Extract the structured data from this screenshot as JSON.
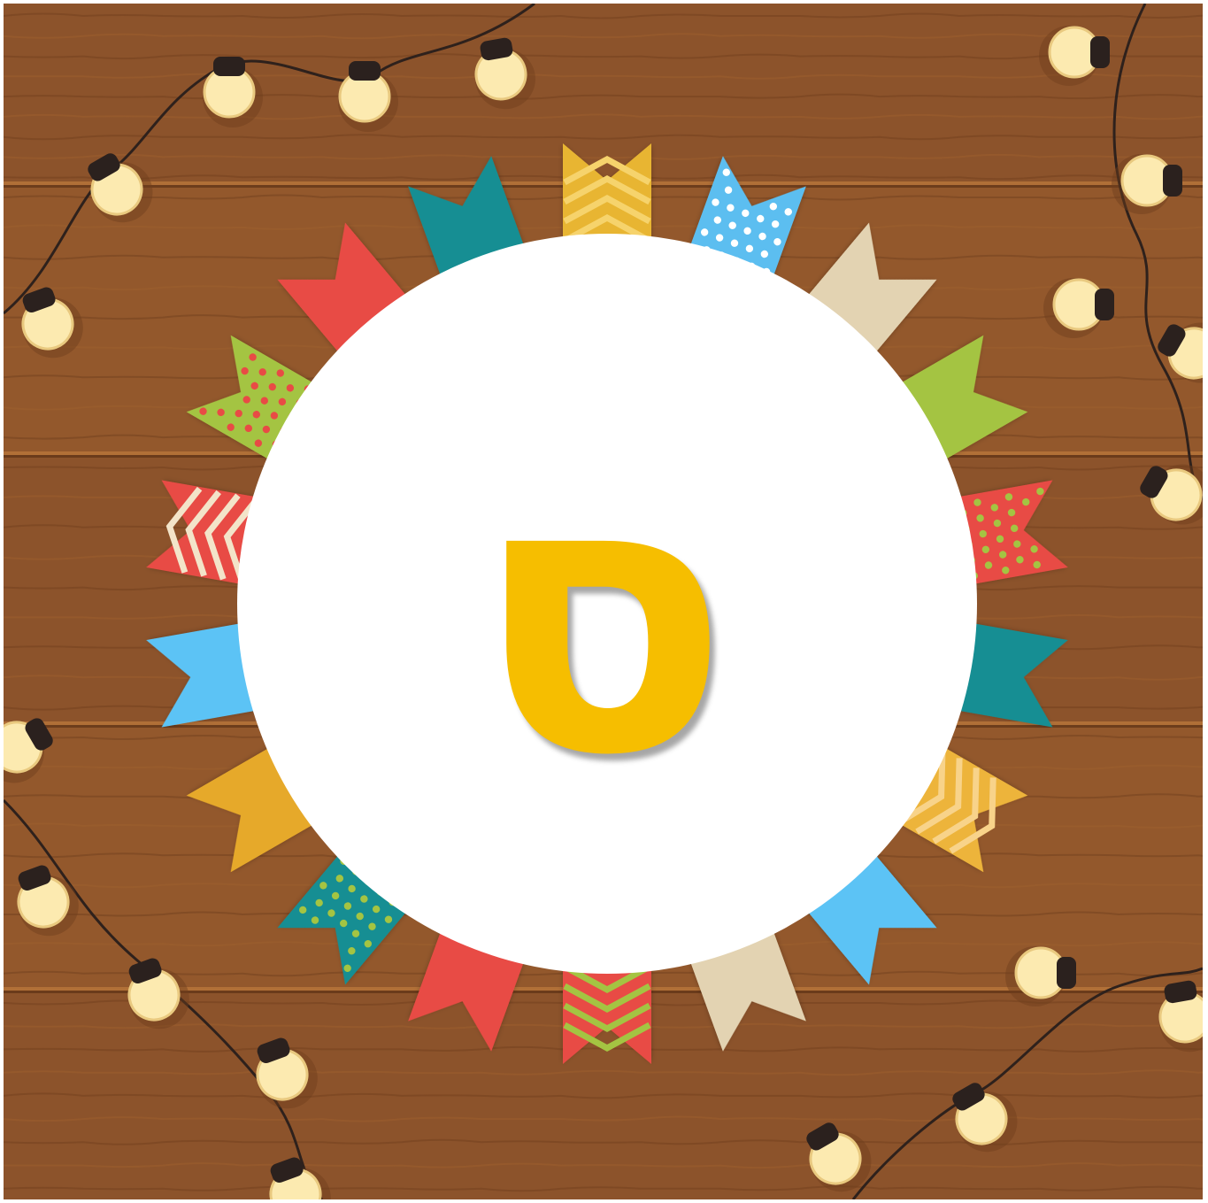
{
  "glyph": {
    "char": "ס",
    "name": "hebrew-letter-samekh"
  },
  "colors": {
    "wood": "#8C532B",
    "wood_light": "#A0622F",
    "wood_dark": "#6E3E1C",
    "circle": "#FFFFFF",
    "glyph": "#F6BE00",
    "bulb": "#FCEAB0",
    "bulb_cap": "#2B211E",
    "wire": "#2E211C"
  },
  "flags": [
    {
      "style": "chevron",
      "colors": [
        "#E8B532",
        "#F6D36C"
      ]
    },
    {
      "style": "dots",
      "colors": [
        "#5BBEF0",
        "#FFFFFF"
      ]
    },
    {
      "style": "solid",
      "colors": [
        "#E3D3B2"
      ]
    },
    {
      "style": "solid",
      "colors": [
        "#A4C442"
      ]
    },
    {
      "style": "dots",
      "colors": [
        "#E84B45",
        "#A4C442"
      ]
    },
    {
      "style": "solid",
      "colors": [
        "#138E93"
      ]
    },
    {
      "style": "chevron",
      "colors": [
        "#EDB43A",
        "#F8D38A"
      ]
    },
    {
      "style": "solid",
      "colors": [
        "#5BC3F5"
      ]
    },
    {
      "style": "solid",
      "colors": [
        "#E3D3B2"
      ]
    },
    {
      "style": "chevron",
      "colors": [
        "#E84B45",
        "#A4C442"
      ]
    },
    {
      "style": "solid",
      "colors": [
        "#E84B45"
      ]
    },
    {
      "style": "dots",
      "colors": [
        "#138E93",
        "#A4C442"
      ]
    },
    {
      "style": "solid",
      "colors": [
        "#E6A92B"
      ]
    },
    {
      "style": "solid",
      "colors": [
        "#5BC3F5"
      ]
    },
    {
      "style": "chevron",
      "colors": [
        "#E84B45",
        "#F3E4C9"
      ]
    },
    {
      "style": "dots",
      "colors": [
        "#A4C442",
        "#E84B45"
      ]
    },
    {
      "style": "solid",
      "colors": [
        "#E84B45"
      ]
    },
    {
      "style": "solid",
      "colors": [
        "#138E93"
      ]
    }
  ]
}
